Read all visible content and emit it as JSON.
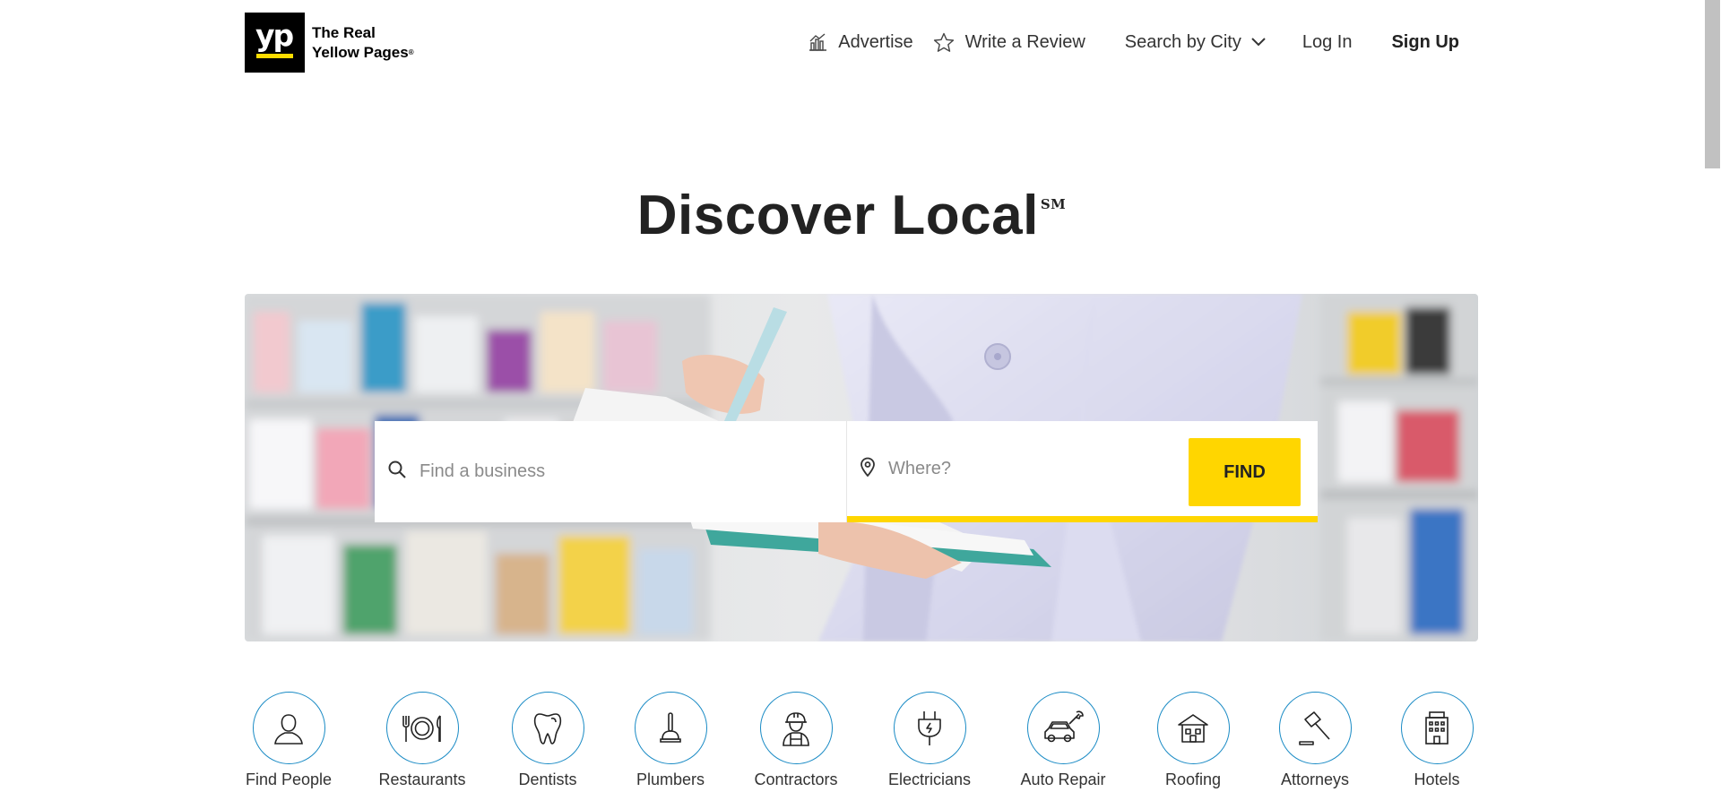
{
  "brand": {
    "logo_mark": "yp",
    "name_line1": "The Real",
    "name_line2": "Yellow Pages",
    "registered": "®",
    "accent_color": "#ffdd00"
  },
  "nav": {
    "advertise": "Advertise",
    "write_review": "Write a Review",
    "search_by_city": "Search by City",
    "log_in": "Log In",
    "sign_up": "Sign Up"
  },
  "hero": {
    "title": "Discover Local",
    "mark": "SM"
  },
  "search": {
    "what_placeholder": "Find a business",
    "what_value": "",
    "where_placeholder": "Where?",
    "where_value": "",
    "find_label": "FIND",
    "button_color": "#ffd600"
  },
  "categories": [
    {
      "label": "Find People",
      "icon": "person-icon"
    },
    {
      "label": "Restaurants",
      "icon": "plate-utensils-icon"
    },
    {
      "label": "Dentists",
      "icon": "tooth-icon"
    },
    {
      "label": "Plumbers",
      "icon": "plunger-icon"
    },
    {
      "label": "Contractors",
      "icon": "worker-icon"
    },
    {
      "label": "Electricians",
      "icon": "plug-icon"
    },
    {
      "label": "Auto Repair",
      "icon": "car-wrench-icon"
    },
    {
      "label": "Roofing",
      "icon": "house-icon"
    },
    {
      "label": "Attorneys",
      "icon": "gavel-icon"
    },
    {
      "label": "Hotels",
      "icon": "hotel-icon"
    }
  ],
  "category_ring_color": "#1a8bc5"
}
